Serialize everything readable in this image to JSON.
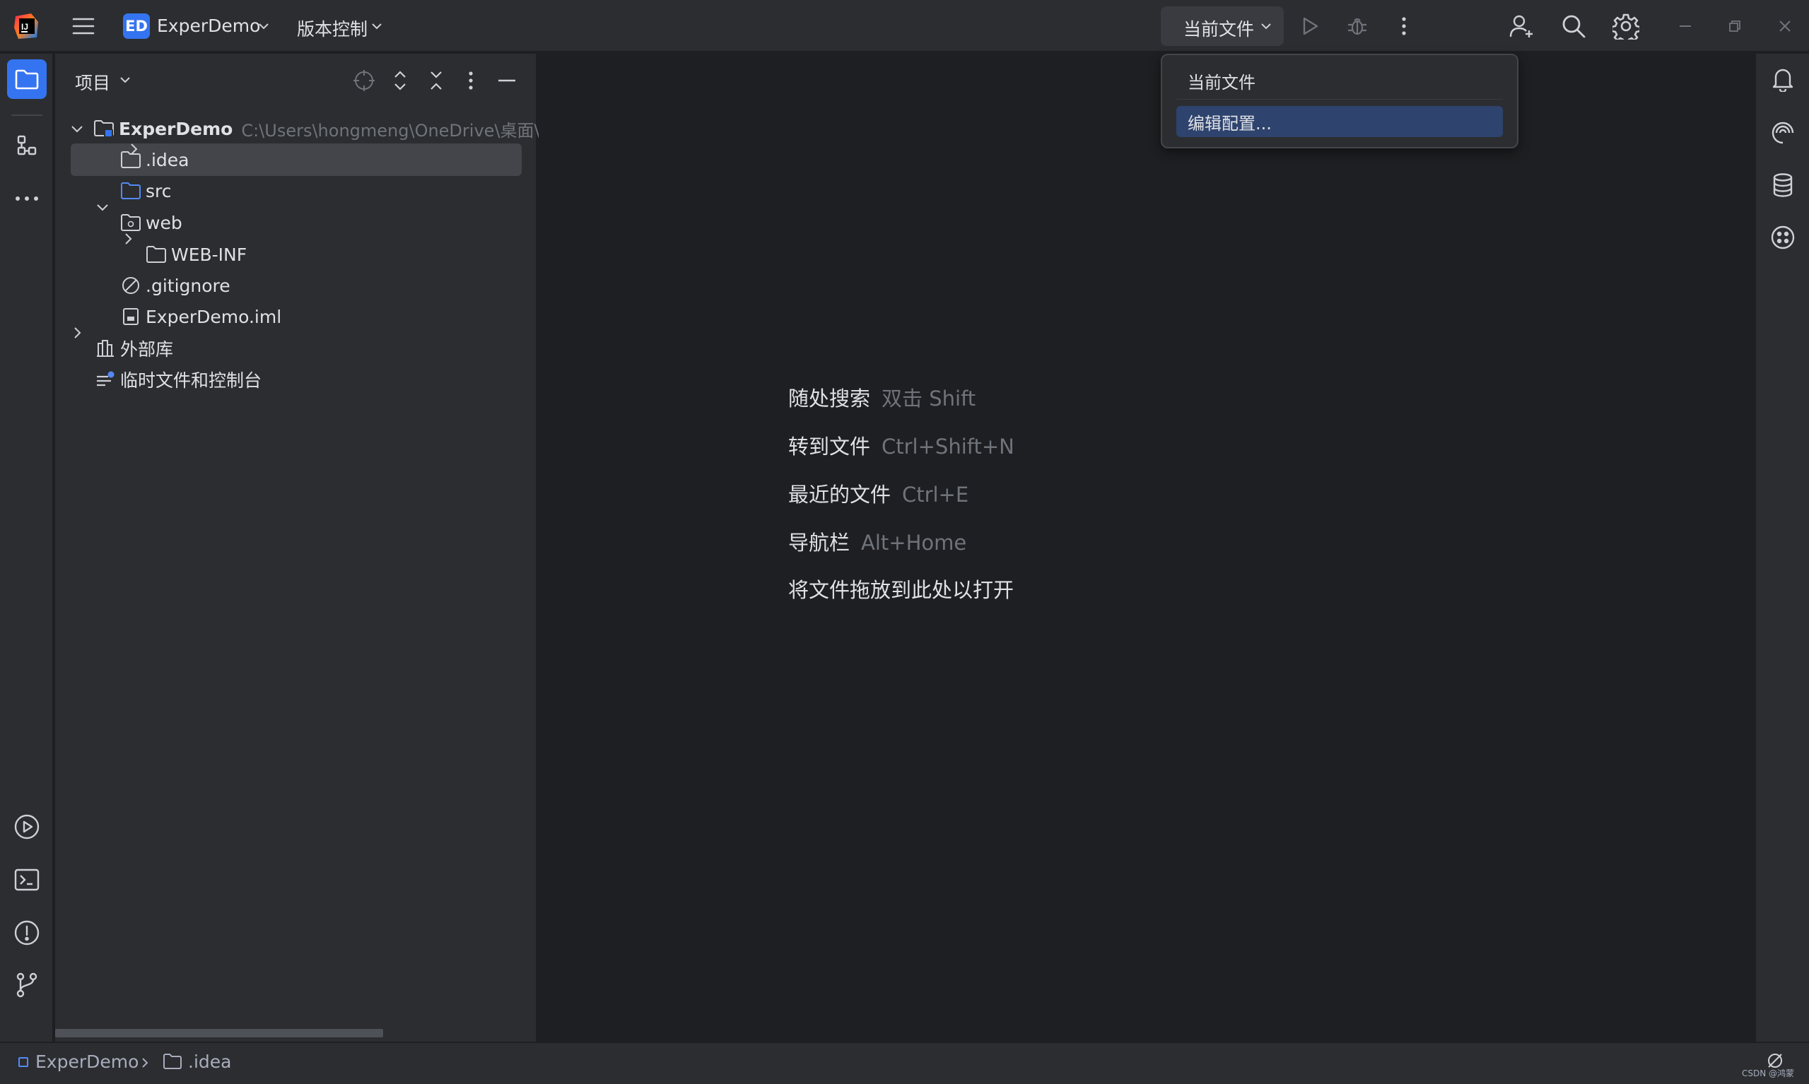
{
  "titlebar": {
    "project_badge": "ED",
    "project_name": "ExperDemo",
    "vcs_label": "版本控制",
    "run_config_label": "当前文件"
  },
  "dropdown": {
    "items": [
      {
        "label": "当前文件",
        "highlighted": false
      },
      {
        "label": "编辑配置...",
        "highlighted": true
      }
    ]
  },
  "project_panel": {
    "title": "项目",
    "tree": [
      {
        "label": "ExperDemo",
        "path": "C:\\Users\\hongmeng\\OneDrive\\桌面\\配",
        "icon": "module-folder-icon",
        "expanded": true
      },
      {
        "label": ".idea",
        "icon": "folder-icon",
        "expanded": false,
        "selected": true
      },
      {
        "label": "src",
        "icon": "source-folder-icon"
      },
      {
        "label": "web",
        "icon": "web-folder-icon",
        "expanded": true
      },
      {
        "label": "WEB-INF",
        "icon": "folder-icon",
        "expanded": false
      },
      {
        "label": ".gitignore",
        "icon": "ignored-file-icon"
      },
      {
        "label": "ExperDemo.iml",
        "icon": "iml-file-icon"
      },
      {
        "label": "外部库",
        "icon": "library-icon",
        "expanded": false
      },
      {
        "label": "临时文件和控制台",
        "icon": "scratches-icon"
      }
    ]
  },
  "editor_hints": [
    {
      "label": "随处搜索",
      "shortcut": "双击 Shift"
    },
    {
      "label": "转到文件",
      "shortcut": "Ctrl+Shift+N"
    },
    {
      "label": "最近的文件",
      "shortcut": "Ctrl+E"
    },
    {
      "label": "导航栏",
      "shortcut": "Alt+Home"
    },
    {
      "label": "将文件拖放到此处以打开",
      "shortcut": ""
    }
  ],
  "statusbar": {
    "breadcrumb": [
      "ExperDemo",
      ".idea"
    ],
    "watermark": "CSDN @鸿蒙"
  },
  "colors": {
    "accent": "#3574f0",
    "panel_bg": "#2b2d30",
    "editor_bg": "#1e1f22",
    "selection": "#43454a",
    "menu_highlight": "#2e436e",
    "folder_blue": "#548af7"
  }
}
